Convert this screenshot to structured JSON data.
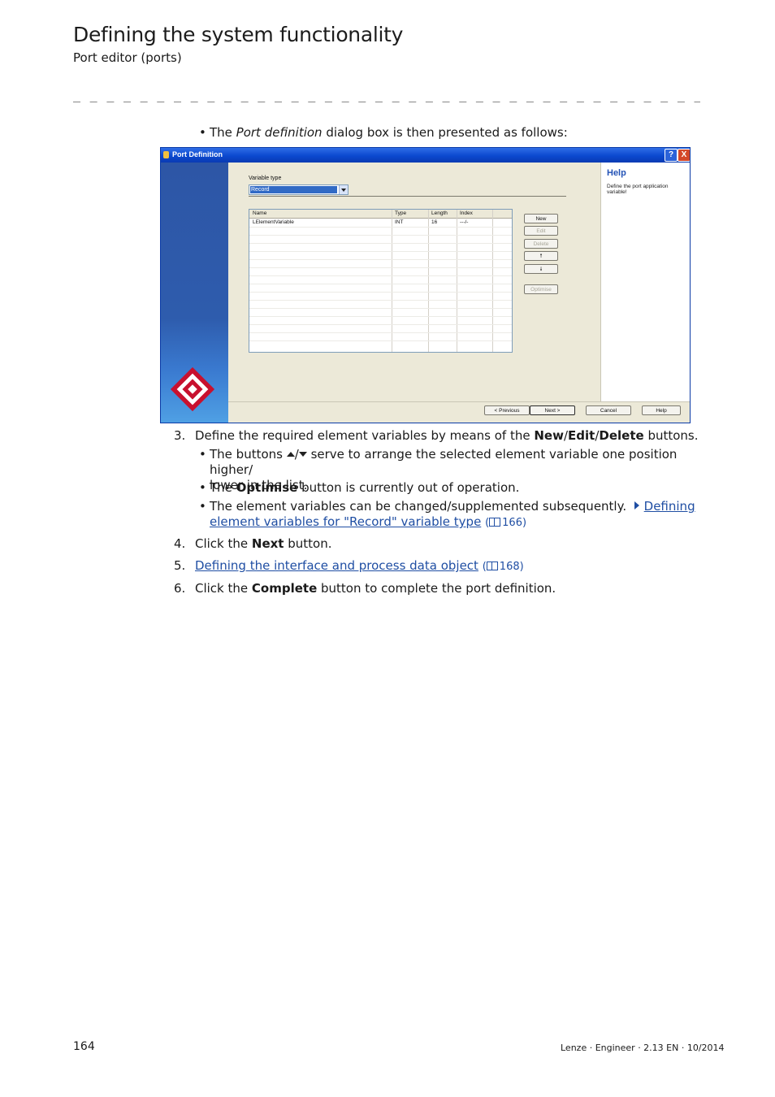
{
  "header": {
    "title": "Defining the system functionality",
    "subtitle": "Port editor (ports)",
    "rule": "_ _ _ _ _ _ _ _ _ _ _ _ _ _ _ _ _ _ _ _ _ _ _ _ _ _ _ _ _ _ _ _ _ _ _ _ _ _ _ _ _ _ _ _ _ _ _ _ _ _ _ _ _ _ _ _ _ _ _ _ _ _ _ _"
  },
  "intro": {
    "bullet": "•",
    "pre": "The ",
    "italic": "Port definition",
    "post": " dialog box is then presented as follows:"
  },
  "dialog": {
    "title": "Port Definition",
    "help_btn": "?",
    "close_btn": "X",
    "variable_type_label": "Variable type",
    "variable_type_value": "Record",
    "columns": [
      "Name",
      "Type",
      "Length",
      "Index"
    ],
    "rows": [
      {
        "name": "LElementVariable",
        "type": "INT",
        "length": "16",
        "index": "---/-"
      }
    ],
    "buttons": {
      "new": "New",
      "edit": "Edit",
      "delete": "Delete",
      "up": "🠕",
      "down": "🠗",
      "optimise": "Optimise"
    },
    "help_title": "Help",
    "help_text": "Define the port application variable!",
    "footer_buttons": {
      "previous": "< Previous",
      "next": "Next >",
      "cancel": "Cancel",
      "help": "Help"
    }
  },
  "steps": {
    "s3": {
      "num": "3.",
      "pre": "Define the required element variables by means of the ",
      "new": "New",
      "slash1": "/",
      "edit": "Edit",
      "slash2": "/",
      "delete": "Delete",
      "post": " buttons."
    },
    "b1": {
      "pre": "The buttons ",
      "slash": "/",
      "post1": " serve to arrange the selected element variable one position higher/",
      "post2": "lower in the list."
    },
    "b2": {
      "pre": "The ",
      "bold": "Optimise",
      "post": " button is currently out of operation."
    },
    "b3": {
      "pre": "The element variables can be changed/supplemented subsequently.",
      "link1": "Defining ",
      "link2": "element variables for \"Record\" variable type",
      "ref": "166"
    },
    "s4": {
      "num": "4.",
      "pre": "Click the ",
      "bold": "Next",
      "post": " button."
    },
    "s5": {
      "num": "5.",
      "link": "Defining the interface and process data object",
      "ref": "168"
    },
    "s6": {
      "num": "6.",
      "pre": "Click the ",
      "bold": "Complete",
      "post": " button to complete the port definition."
    }
  },
  "footer": {
    "page": "164",
    "doc": "Lenze · Engineer · 2.13 EN · 10/2014"
  }
}
